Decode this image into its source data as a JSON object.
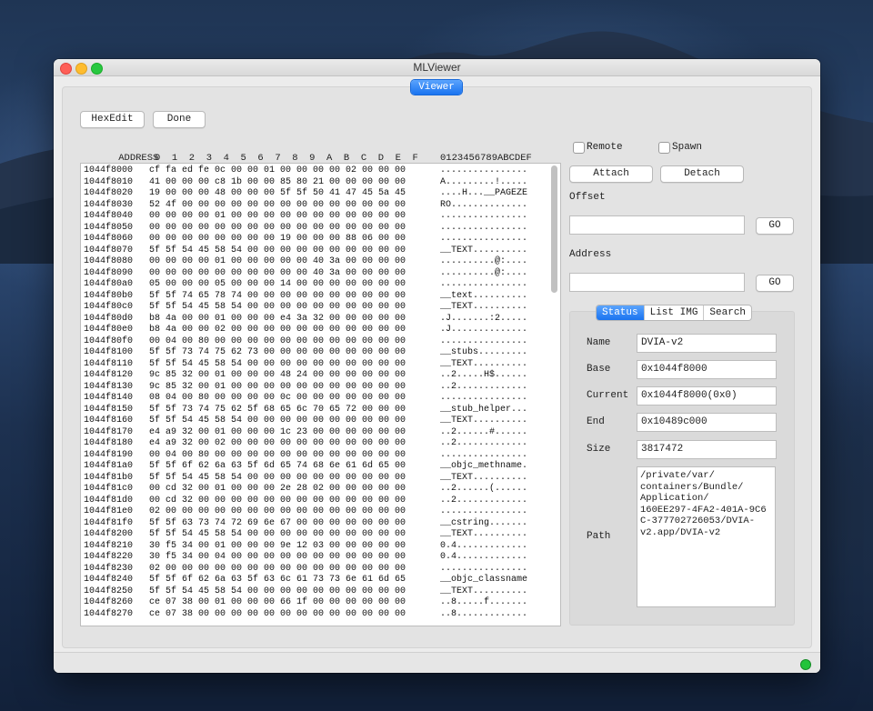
{
  "window": {
    "title": "MLViewer"
  },
  "tabs": {
    "viewer": "Viewer"
  },
  "toolbar": {
    "hexedit": "HexEdit",
    "done": "Done"
  },
  "hex": {
    "header_address": "ADDRESS",
    "header_columns": "0  1  2  3  4  5  6  7  8  9  A  B  C  D  E  F",
    "header_ascii": "0123456789ABCDEF",
    "rows": [
      {
        "addr": "1044f8000",
        "bytes": "cf fa ed fe 0c 00 00 01 00 00 00 00 02 00 00 00",
        "ascii": "................"
      },
      {
        "addr": "1044f8010",
        "bytes": "41 00 00 00 c8 1b 00 00 85 80 21 00 00 00 00 00",
        "ascii": "A.........!....."
      },
      {
        "addr": "1044f8020",
        "bytes": "19 00 00 00 48 00 00 00 5f 5f 50 41 47 45 5a 45",
        "ascii": "....H...__PAGEZE"
      },
      {
        "addr": "1044f8030",
        "bytes": "52 4f 00 00 00 00 00 00 00 00 00 00 00 00 00 00",
        "ascii": "RO.............."
      },
      {
        "addr": "1044f8040",
        "bytes": "00 00 00 00 01 00 00 00 00 00 00 00 00 00 00 00",
        "ascii": "................"
      },
      {
        "addr": "1044f8050",
        "bytes": "00 00 00 00 00 00 00 00 00 00 00 00 00 00 00 00",
        "ascii": "................"
      },
      {
        "addr": "1044f8060",
        "bytes": "00 00 00 00 00 00 00 00 19 00 00 00 88 06 00 00",
        "ascii": "................"
      },
      {
        "addr": "1044f8070",
        "bytes": "5f 5f 54 45 58 54 00 00 00 00 00 00 00 00 00 00",
        "ascii": "__TEXT.........."
      },
      {
        "addr": "1044f8080",
        "bytes": "00 00 00 00 01 00 00 00 00 00 40 3a 00 00 00 00",
        "ascii": "..........@:...."
      },
      {
        "addr": "1044f8090",
        "bytes": "00 00 00 00 00 00 00 00 00 00 40 3a 00 00 00 00",
        "ascii": "..........@:...."
      },
      {
        "addr": "1044f80a0",
        "bytes": "05 00 00 00 05 00 00 00 14 00 00 00 00 00 00 00",
        "ascii": "................"
      },
      {
        "addr": "1044f80b0",
        "bytes": "5f 5f 74 65 78 74 00 00 00 00 00 00 00 00 00 00",
        "ascii": "__text.........."
      },
      {
        "addr": "1044f80c0",
        "bytes": "5f 5f 54 45 58 54 00 00 00 00 00 00 00 00 00 00",
        "ascii": "__TEXT.........."
      },
      {
        "addr": "1044f80d0",
        "bytes": "b8 4a 00 00 01 00 00 00 e4 3a 32 00 00 00 00 00",
        "ascii": ".J.......:2....."
      },
      {
        "addr": "1044f80e0",
        "bytes": "b8 4a 00 00 02 00 00 00 00 00 00 00 00 00 00 00",
        "ascii": ".J.............."
      },
      {
        "addr": "1044f80f0",
        "bytes": "00 04 00 80 00 00 00 00 00 00 00 00 00 00 00 00",
        "ascii": "................"
      },
      {
        "addr": "1044f8100",
        "bytes": "5f 5f 73 74 75 62 73 00 00 00 00 00 00 00 00 00",
        "ascii": "__stubs........."
      },
      {
        "addr": "1044f8110",
        "bytes": "5f 5f 54 45 58 54 00 00 00 00 00 00 00 00 00 00",
        "ascii": "__TEXT.........."
      },
      {
        "addr": "1044f8120",
        "bytes": "9c 85 32 00 01 00 00 00 48 24 00 00 00 00 00 00",
        "ascii": "..2.....H$......"
      },
      {
        "addr": "1044f8130",
        "bytes": "9c 85 32 00 01 00 00 00 00 00 00 00 00 00 00 00",
        "ascii": "..2............."
      },
      {
        "addr": "1044f8140",
        "bytes": "08 04 00 80 00 00 00 00 0c 00 00 00 00 00 00 00",
        "ascii": "................"
      },
      {
        "addr": "1044f8150",
        "bytes": "5f 5f 73 74 75 62 5f 68 65 6c 70 65 72 00 00 00",
        "ascii": "__stub_helper..."
      },
      {
        "addr": "1044f8160",
        "bytes": "5f 5f 54 45 58 54 00 00 00 00 00 00 00 00 00 00",
        "ascii": "__TEXT.........."
      },
      {
        "addr": "1044f8170",
        "bytes": "e4 a9 32 00 01 00 00 00 1c 23 00 00 00 00 00 00",
        "ascii": "..2......#......"
      },
      {
        "addr": "1044f8180",
        "bytes": "e4 a9 32 00 02 00 00 00 00 00 00 00 00 00 00 00",
        "ascii": "..2............."
      },
      {
        "addr": "1044f8190",
        "bytes": "00 04 00 80 00 00 00 00 00 00 00 00 00 00 00 00",
        "ascii": "................"
      },
      {
        "addr": "1044f81a0",
        "bytes": "5f 5f 6f 62 6a 63 5f 6d 65 74 68 6e 61 6d 65 00",
        "ascii": "__objc_methname."
      },
      {
        "addr": "1044f81b0",
        "bytes": "5f 5f 54 45 58 54 00 00 00 00 00 00 00 00 00 00",
        "ascii": "__TEXT.........."
      },
      {
        "addr": "1044f81c0",
        "bytes": "00 cd 32 00 01 00 00 00 2e 28 02 00 00 00 00 00",
        "ascii": "..2......(......"
      },
      {
        "addr": "1044f81d0",
        "bytes": "00 cd 32 00 00 00 00 00 00 00 00 00 00 00 00 00",
        "ascii": "..2............."
      },
      {
        "addr": "1044f81e0",
        "bytes": "02 00 00 00 00 00 00 00 00 00 00 00 00 00 00 00",
        "ascii": "................"
      },
      {
        "addr": "1044f81f0",
        "bytes": "5f 5f 63 73 74 72 69 6e 67 00 00 00 00 00 00 00",
        "ascii": "__cstring......."
      },
      {
        "addr": "1044f8200",
        "bytes": "5f 5f 54 45 58 54 00 00 00 00 00 00 00 00 00 00",
        "ascii": "__TEXT.........."
      },
      {
        "addr": "1044f8210",
        "bytes": "30 f5 34 00 01 00 00 00 9e 12 03 00 00 00 00 00",
        "ascii": "0.4............."
      },
      {
        "addr": "1044f8220",
        "bytes": "30 f5 34 00 04 00 00 00 00 00 00 00 00 00 00 00",
        "ascii": "0.4............."
      },
      {
        "addr": "1044f8230",
        "bytes": "02 00 00 00 00 00 00 00 00 00 00 00 00 00 00 00",
        "ascii": "................"
      },
      {
        "addr": "1044f8240",
        "bytes": "5f 5f 6f 62 6a 63 5f 63 6c 61 73 73 6e 61 6d 65",
        "ascii": "__objc_classname"
      },
      {
        "addr": "1044f8250",
        "bytes": "5f 5f 54 45 58 54 00 00 00 00 00 00 00 00 00 00",
        "ascii": "__TEXT.........."
      },
      {
        "addr": "1044f8260",
        "bytes": "ce 07 38 00 01 00 00 00 66 1f 00 00 00 00 00 00",
        "ascii": "..8.....f......."
      },
      {
        "addr": "1044f8270",
        "bytes": "ce 07 38 00 00 00 00 00 00 00 00 00 00 00 00 00",
        "ascii": "..8............."
      }
    ]
  },
  "right": {
    "remote_label": "Remote",
    "spawn_label": "Spawn",
    "attach": "Attach",
    "detach": "Detach",
    "offset_label": "Offset",
    "offset_value": "",
    "address_label": "Address",
    "address_value": "",
    "go": "GO"
  },
  "status_tabs": {
    "status": "Status",
    "list_img": "List IMG",
    "search": "Search"
  },
  "status": {
    "name_label": "Name",
    "name": "DVIA-v2",
    "base_label": "Base",
    "base": "0x1044f8000",
    "current_label": "Current",
    "current": "0x1044f8000(0x0)",
    "end_label": "End",
    "end": "0x10489c000",
    "size_label": "Size",
    "size": "3817472",
    "path_label": "Path",
    "path": "/private/var/\ncontainers/Bundle/\nApplication/\n160EE297-4FA2-401A-9C6\nC-377702726053/DVIA-\nv2.app/DVIA-v2"
  },
  "colors": {
    "accent": "#1a73f0",
    "status_ok": "#22c43a"
  }
}
